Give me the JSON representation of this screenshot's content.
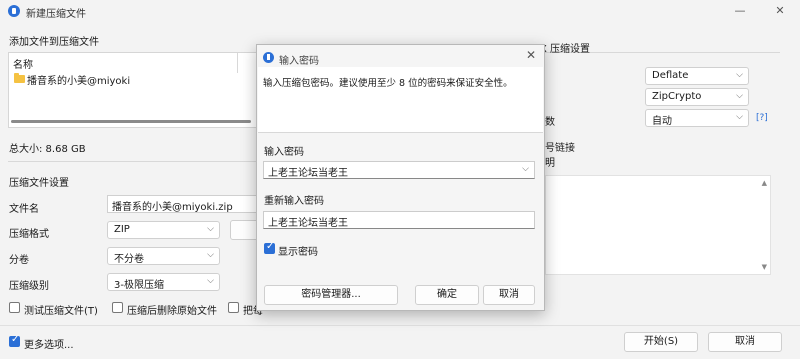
{
  "window": {
    "title": "新建压缩文件"
  },
  "add_files": {
    "heading": "添加文件到压缩文件",
    "column_name": "名称",
    "items": [
      {
        "name": "播音系的小美@miyoki"
      }
    ]
  },
  "total_size": "总大小: 8.68 GB",
  "settings": {
    "heading": "压缩文件设置",
    "filename_label": "文件名",
    "filename_value": "播音系的小美@miyoki.zip",
    "format_label": "压缩格式",
    "format_value": "ZIP",
    "volume_label": "分卷",
    "volume_value": "不分卷",
    "level_label": "压缩级别",
    "level_value": "3-极限压缩"
  },
  "options": {
    "test_after": "测试压缩文件(T)",
    "delete_after": "压缩后删除原始文件",
    "partial": "把每"
  },
  "more_options": "更多选项...",
  "right_panel": {
    "heading": "ZIP/ZIPX 压缩设置",
    "method_value": "Deflate",
    "encryption_value": "ZipCrypto",
    "threads_label_partial": "数",
    "threads_value": "自动",
    "help_link": "[?]",
    "symlink_partial": "号链接",
    "desc_partial": "明"
  },
  "footer": {
    "start_button": "开始(S)",
    "cancel_button": "取消"
  },
  "dialog": {
    "title": "输入密码",
    "hint": "输入压缩包密码。建议使用至少 8 位的密码来保证安全性。",
    "password_label": "输入密码",
    "password_value": "上老王论坛当老王",
    "reenter_label": "重新输入密码",
    "reenter_value": "上老王论坛当老王",
    "show_password": "显示密码",
    "manager_button": "密码管理器...",
    "ok_button": "确定",
    "cancel_button": "取消"
  }
}
